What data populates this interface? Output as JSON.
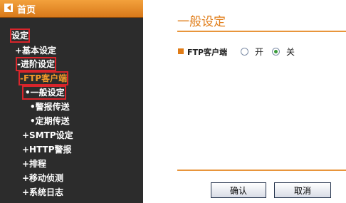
{
  "sidebar": {
    "home": "首页",
    "settings": "设定",
    "basic_settings": "+基本设定",
    "advanced_settings": "-进阶设定",
    "ftp_client": "-FTP客户端",
    "general_settings": "一般设定",
    "alarm_transfer": "警报传送",
    "scheduled_transfer": "定期传送",
    "smtp_settings": "+SMTP设定",
    "http_alarm": "+HTTP警报",
    "schedule": "+排程",
    "motion_detection": "+移动侦测",
    "system_log": "+系统日志"
  },
  "main": {
    "title": "一般设定",
    "ftp_label": "FTP客户端",
    "option_on": "开",
    "option_off": "关",
    "selected": "关",
    "confirm_button": "确认",
    "cancel_button": "取消"
  },
  "colors": {
    "accent": "#e07c17",
    "sidebar_bg": "#2c2c2c",
    "highlight_box": "#d8252b"
  }
}
